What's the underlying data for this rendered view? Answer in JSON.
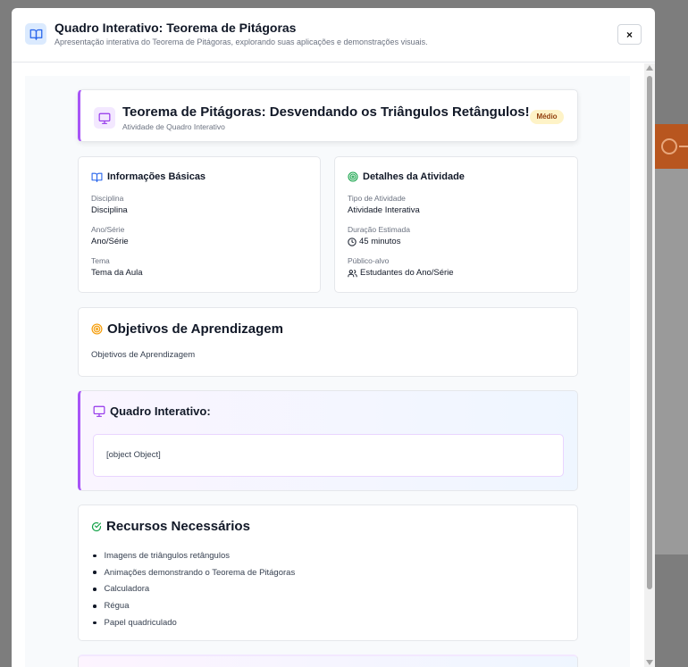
{
  "modal": {
    "title": "Quadro Interativo: Teorema de Pitágoras",
    "subtitle": "Apresentação interativa do Teorema de Pitágoras, explorando suas aplicações e demonstrações visuais.",
    "close_label": "×",
    "header_icon": "book-open-icon"
  },
  "activity": {
    "title": "Teorema de Pitágoras: Desvendando os Triângulos Retângulos!",
    "subtitle": "Atividade de Quadro Interativo",
    "badge": "Médio",
    "icon": "monitor-icon"
  },
  "basic_info": {
    "heading": "Informações Básicas",
    "icon": "book-open-icon",
    "fields": [
      {
        "label": "Disciplina",
        "value": "Disciplina"
      },
      {
        "label": "Ano/Série",
        "value": "Ano/Série"
      },
      {
        "label": "Tema",
        "value": "Tema da Aula"
      }
    ]
  },
  "activity_details": {
    "heading": "Detalhes da Atividade",
    "icon": "target-icon",
    "fields": [
      {
        "label": "Tipo de Atividade",
        "value": "Atividade Interativa"
      },
      {
        "label": "Duração Estimada",
        "value": "45 minutos",
        "icon": "clock-icon"
      },
      {
        "label": "Público-alvo",
        "value": "Estudantes do Ano/Série",
        "icon": "users-icon"
      }
    ]
  },
  "objectives": {
    "heading": "Objetivos de Aprendizagem",
    "text": "Objetivos de Aprendizagem",
    "icon": "target-icon"
  },
  "board": {
    "heading": "Quadro Interativo:",
    "content": "[object Object]",
    "icon": "monitor-icon"
  },
  "resources": {
    "heading": "Recursos Necessários",
    "icon": "check-circle-icon",
    "items": [
      "Imagens de triângulos retângulos",
      "Animações demonstrando o Teorema de Pitágoras",
      "Calculadora",
      "Régua",
      "Papel quadriculado"
    ]
  },
  "colors": {
    "accent_purple": "#a855f7",
    "accent_blue": "#2563eb",
    "target_green": "#16a34a",
    "target_orange": "#f59e0b",
    "badge_bg": "#fef3c7"
  }
}
